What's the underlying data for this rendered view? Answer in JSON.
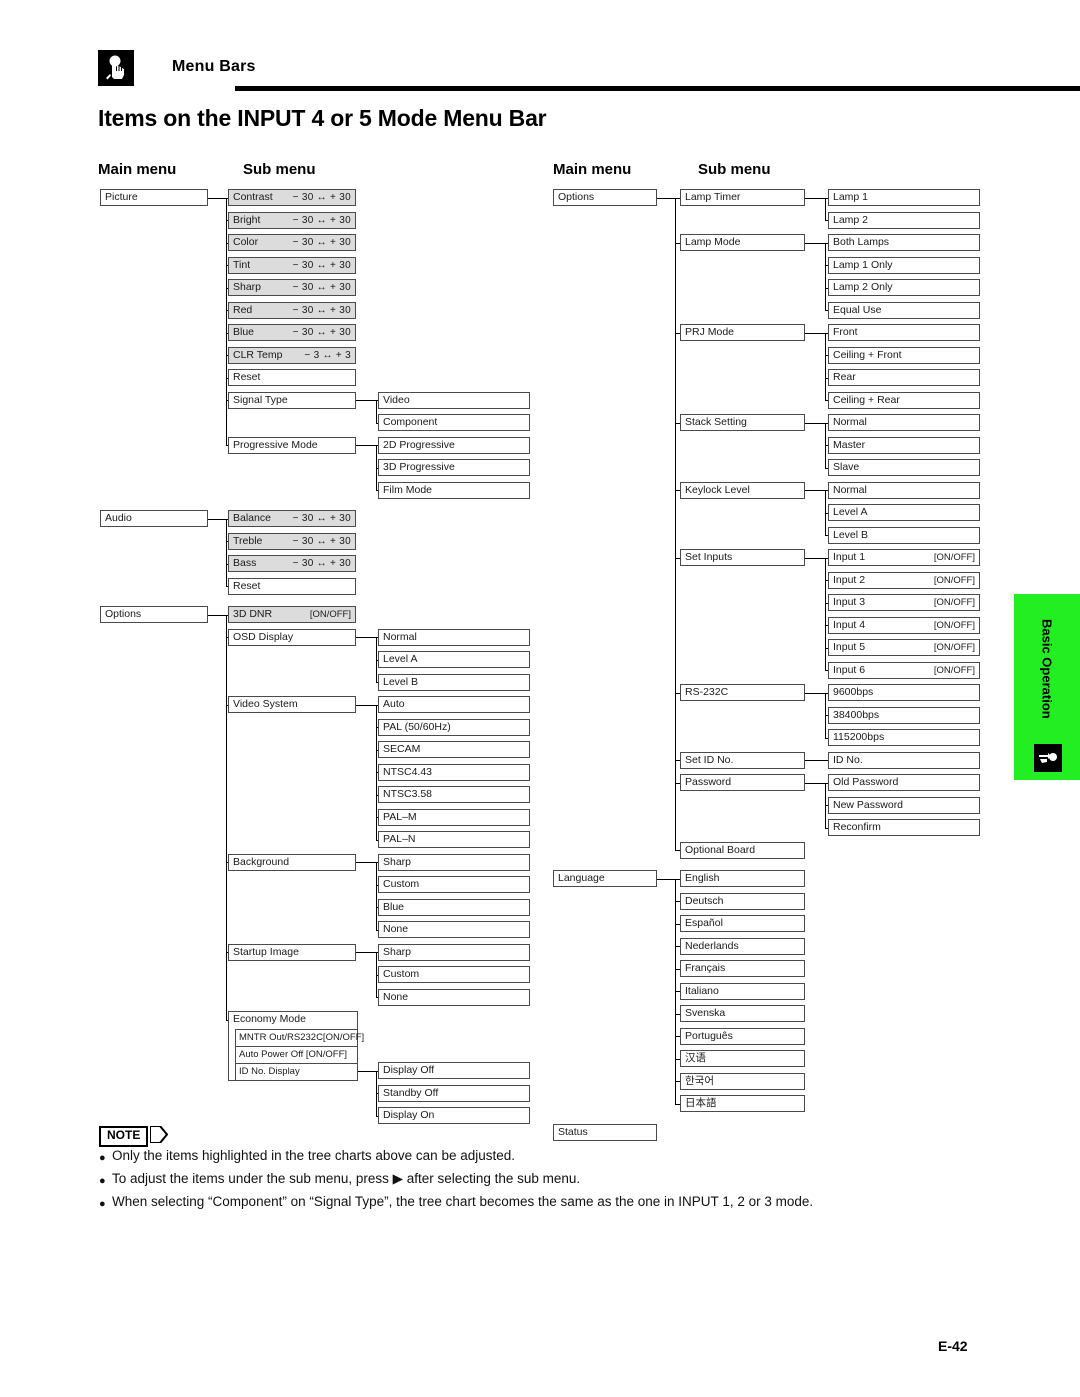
{
  "header": {
    "section_label": "Menu Bars",
    "icon": "hand-pointer-icon",
    "page_title": "Items on the INPUT 4 or 5 Mode Menu Bar"
  },
  "captions": {
    "main_menu": "Main menu",
    "sub_menu": "Sub menu"
  },
  "side_tab": {
    "label": "Basic Operation",
    "icon": "hand-pointer-icon",
    "color": "#22ee22"
  },
  "footer": {
    "page_number": "E-42"
  },
  "note": {
    "badge": "NOTE",
    "arrow_icon": "triangle-right-icon",
    "lines": [
      "Only the items highlighted in the tree charts above can be adjusted.",
      "To adjust the items under the sub menu, press ▶ after selecting the sub menu.",
      "When selecting “Component” on “Signal Type”, the tree chart becomes the same as the one in INPUT 1, 2 or 3 mode."
    ]
  },
  "chart_data": {
    "type": "tree",
    "title": "Items on the INPUT 4 or 5 Mode Menu Bar",
    "legend": {
      "shaded": "adjustable item"
    },
    "left_column": [
      {
        "main": "Picture",
        "sub": [
          {
            "label": "Contrast",
            "value": "− 30 ↔ + 30",
            "shaded": true
          },
          {
            "label": "Bright",
            "value": "− 30 ↔ + 30",
            "shaded": true
          },
          {
            "label": "Color",
            "value": "− 30 ↔ + 30",
            "shaded": true
          },
          {
            "label": "Tint",
            "value": "− 30 ↔ + 30",
            "shaded": true
          },
          {
            "label": "Sharp",
            "value": "− 30 ↔ + 30",
            "shaded": true
          },
          {
            "label": "Red",
            "value": "− 30 ↔ + 30",
            "shaded": true
          },
          {
            "label": "Blue",
            "value": "− 30 ↔ + 30",
            "shaded": true
          },
          {
            "label": "CLR Temp",
            "value": "− 3 ↔ + 3",
            "shaded": true
          },
          {
            "label": "Reset",
            "value": "",
            "shaded": false
          },
          {
            "label": "Signal Type",
            "value": "",
            "shaded": false,
            "sub2": [
              "Video",
              "Component"
            ]
          },
          {
            "label": "Progressive Mode",
            "value": "",
            "shaded": false,
            "sub2": [
              "2D Progressive",
              "3D Progressive",
              "Film Mode"
            ]
          }
        ]
      },
      {
        "main": "Audio",
        "sub": [
          {
            "label": "Balance",
            "value": "− 30 ↔ + 30",
            "shaded": true
          },
          {
            "label": "Treble",
            "value": "− 30 ↔ + 30",
            "shaded": true
          },
          {
            "label": "Bass",
            "value": "− 30 ↔ + 30",
            "shaded": true
          },
          {
            "label": "Reset",
            "value": "",
            "shaded": false
          }
        ]
      },
      {
        "main": "Options",
        "sub": [
          {
            "label": "3D DNR",
            "value": "[ON/OFF]",
            "shaded": true
          },
          {
            "label": "OSD Display",
            "value": "",
            "shaded": false,
            "sub2": [
              "Normal",
              "Level A",
              "Level B"
            ]
          },
          {
            "label": "Video System",
            "value": "",
            "shaded": false,
            "sub2": [
              "Auto",
              "PAL (50/60Hz)",
              "SECAM",
              "NTSC4.43",
              "NTSC3.58",
              "PAL–M",
              "PAL–N"
            ]
          },
          {
            "label": "Background",
            "value": "",
            "shaded": false,
            "sub2": [
              "Sharp",
              "Custom",
              "Blue",
              "None"
            ]
          },
          {
            "label": "Startup Image",
            "value": "",
            "shaded": false,
            "sub2": [
              "Sharp",
              "Custom",
              "None"
            ]
          },
          {
            "label": "Economy Mode",
            "value": "",
            "shaded": false,
            "group": true,
            "rows": [
              {
                "label": "MNTR Out/RS232C[ON/OFF]"
              },
              {
                "label": "Auto Power Off [ON/OFF]"
              },
              {
                "label": "ID No. Display",
                "sub2": [
                  "Display Off",
                  "Standby Off",
                  "Display On"
                ]
              }
            ]
          }
        ]
      }
    ],
    "right_column": [
      {
        "main": "Options",
        "sub": [
          {
            "label": "Lamp Timer",
            "value": "",
            "shaded": false,
            "sub2": [
              "Lamp 1",
              "Lamp 2"
            ]
          },
          {
            "label": "Lamp Mode",
            "value": "",
            "shaded": false,
            "sub2": [
              "Both Lamps",
              "Lamp 1 Only",
              "Lamp 2 Only",
              "Equal Use"
            ]
          },
          {
            "label": "PRJ Mode",
            "value": "",
            "shaded": false,
            "sub2": [
              "Front",
              "Ceiling + Front",
              "Rear",
              "Ceiling + Rear"
            ]
          },
          {
            "label": "Stack Setting",
            "value": "",
            "shaded": false,
            "sub2": [
              "Normal",
              "Master",
              "Slave"
            ]
          },
          {
            "label": "Keylock Level",
            "value": "",
            "shaded": false,
            "sub2": [
              "Normal",
              "Level A",
              "Level B"
            ]
          },
          {
            "label": "Set Inputs",
            "value": "",
            "shaded": false,
            "sub2_pairs": [
              {
                "label": "Input 1",
                "value": "[ON/OFF]"
              },
              {
                "label": "Input 2",
                "value": "[ON/OFF]"
              },
              {
                "label": "Input 3",
                "value": "[ON/OFF]"
              },
              {
                "label": "Input 4",
                "value": "[ON/OFF]"
              },
              {
                "label": "Input 5",
                "value": "[ON/OFF]"
              },
              {
                "label": "Input 6",
                "value": "[ON/OFF]"
              }
            ]
          },
          {
            "label": "RS-232C",
            "value": "",
            "shaded": false,
            "sub2": [
              "9600bps",
              "38400bps",
              "115200bps"
            ]
          },
          {
            "label": "Set ID No.",
            "value": "",
            "shaded": false,
            "sub2": [
              "ID No."
            ]
          },
          {
            "label": "Password",
            "value": "",
            "shaded": false,
            "sub2": [
              "Old Password",
              "New Password",
              "Reconfirm"
            ]
          },
          {
            "label": "Optional Board",
            "value": "",
            "shaded": false
          }
        ]
      },
      {
        "main": "Language",
        "sub": [
          {
            "label": "English"
          },
          {
            "label": "Deutsch"
          },
          {
            "label": "Español"
          },
          {
            "label": "Nederlands"
          },
          {
            "label": "Français"
          },
          {
            "label": "Italiano"
          },
          {
            "label": "Svenska"
          },
          {
            "label": "Português"
          },
          {
            "label": "汉语"
          },
          {
            "label": "한국어"
          },
          {
            "label": "日本語"
          }
        ]
      },
      {
        "main": "Status",
        "sub": []
      }
    ]
  }
}
